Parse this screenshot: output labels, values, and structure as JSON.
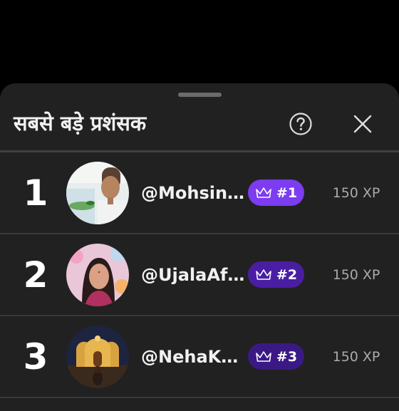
{
  "sheet": {
    "title": "सबसे बड़े प्रशंसक",
    "help_icon": "question-circle-icon",
    "close_icon": "close-x-icon"
  },
  "fans": [
    {
      "rank": "1",
      "handle": "@Mohsin…",
      "badge_label": "#1",
      "badge_color": "#7c3cf0",
      "xp": "150 XP"
    },
    {
      "rank": "2",
      "handle": "@UjalaAf…",
      "badge_label": "#2",
      "badge_color": "#4a1ea3",
      "xp": "150 XP"
    },
    {
      "rank": "3",
      "handle": "@NehaK…",
      "badge_label": "#3",
      "badge_color": "#3b1985",
      "xp": "150 XP"
    }
  ],
  "badge_icon": "crown-icon"
}
